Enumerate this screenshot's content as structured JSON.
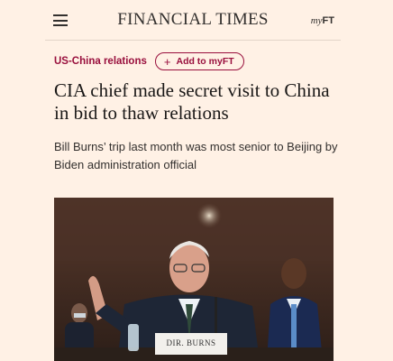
{
  "header": {
    "masthead": "FINANCIAL TIMES",
    "myft_my": "my",
    "myft_ft": "FT"
  },
  "topic": {
    "label": "US-China relations",
    "follow_button": "Add to myFT",
    "follow_icon": "plus-icon"
  },
  "article": {
    "headline": "CIA chief made secret visit to China in bid to thaw relations",
    "standfirst": "Bill Burns’ trip last month was most senior to Beijing by Biden administration official"
  },
  "photo": {
    "nameplate": "DIR. BURNS"
  },
  "colors": {
    "background": "#fff1e5",
    "claret": "#990f3d",
    "text": "#33302e"
  }
}
